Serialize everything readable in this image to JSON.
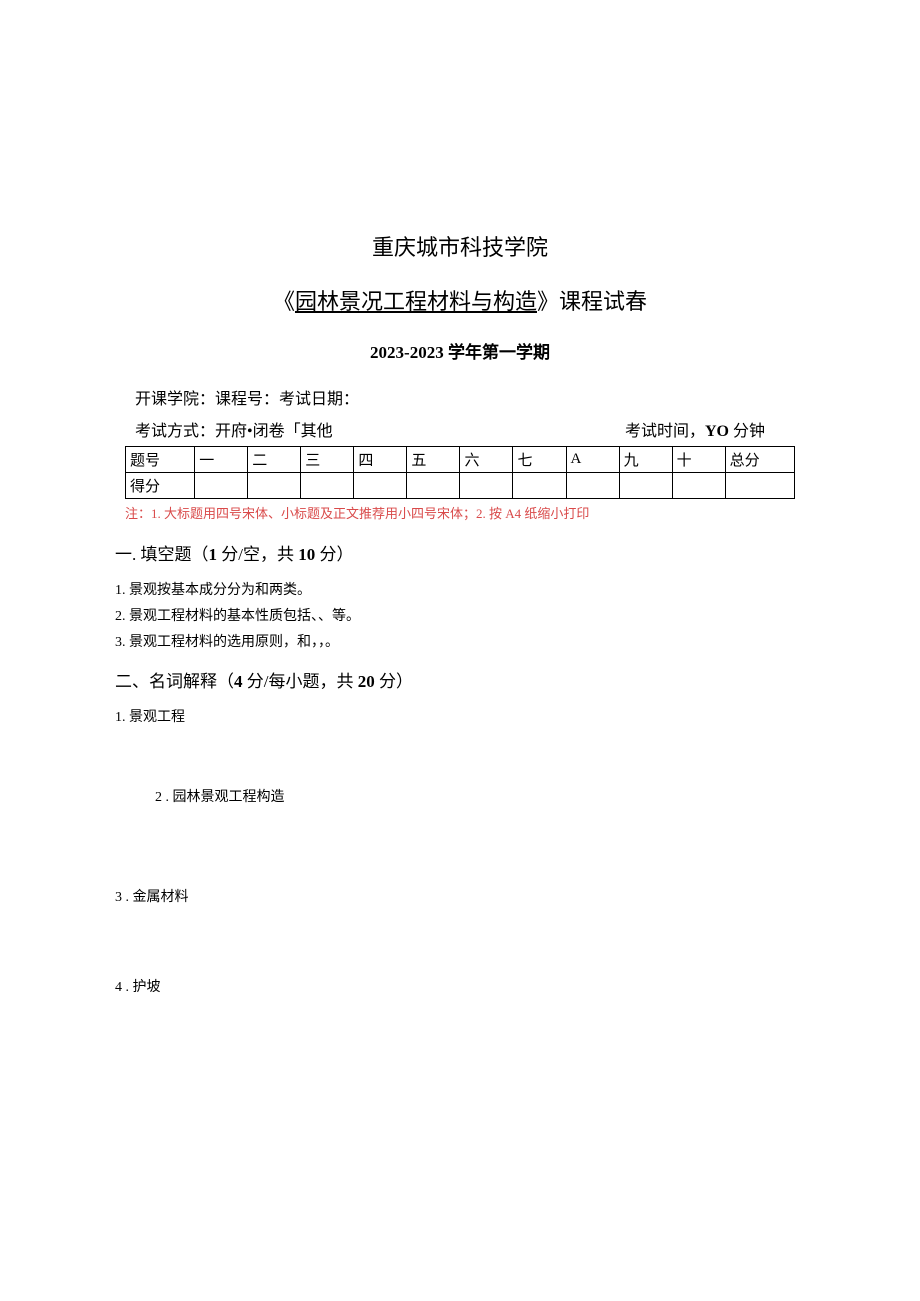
{
  "header": {
    "institution": "重庆城市科技学院",
    "course_prefix": "《",
    "course_name": "园林景况工程材料与构造",
    "course_suffix": "》课程试春",
    "term": "2023-2023 学年第一学期",
    "info_line": "开课学院：课程号：考试日期：",
    "exam_mode": "考试方式：开府•闭卷「其他",
    "exam_time_prefix": "考试时间，",
    "exam_time_value": "YO",
    "exam_time_suffix": " 分钟"
  },
  "table": {
    "row1_label": "题号",
    "row2_label": "得分",
    "headers": [
      "一",
      "二",
      "三",
      "四",
      "五",
      "六",
      "七",
      "A",
      "九",
      "十"
    ],
    "total_label": "总分"
  },
  "note": "注：1. 大标题用四号宋体、小标题及正文推荐用小四号宋体；2. 按 A4 纸缩小打印",
  "section1": {
    "heading_prefix": "一. 填空题（",
    "heading_bold1": "1",
    "heading_mid": " 分/空，共 ",
    "heading_bold2": "10",
    "heading_suffix": " 分）",
    "q1": "1. 景观按基本成分分为和两类。",
    "q2": "2. 景观工程材料的基本性质包括、、等。",
    "q3": "3. 景观工程材料的选用原则，和，，。"
  },
  "section2": {
    "heading_prefix": "二、名词解释（",
    "heading_bold1": "4",
    "heading_mid": " 分/每小题，共 ",
    "heading_bold2": "20",
    "heading_suffix": " 分）",
    "q1": "1. 景观工程",
    "q2": "2  . 园林景观工程构造",
    "q3": "3  . 金属材料",
    "q4": "4  . 护坡"
  }
}
